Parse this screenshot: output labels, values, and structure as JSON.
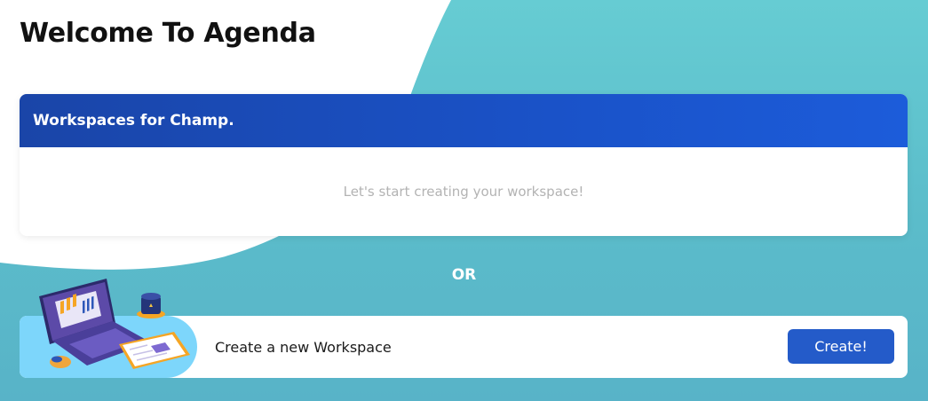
{
  "page": {
    "title": "Welcome To Agenda"
  },
  "workspaces": {
    "header_title": "Workspaces for Champ.",
    "empty_message": "Let's start creating your workspace!"
  },
  "separator": {
    "label": "OR"
  },
  "create": {
    "label": "Create a new Workspace",
    "button_label": "Create!"
  },
  "colors": {
    "header_blue": "#1a4fc0",
    "button_blue": "#245bc9",
    "teal_background": "#5ec3cd",
    "illustration_bg": "#7dd6fb"
  }
}
